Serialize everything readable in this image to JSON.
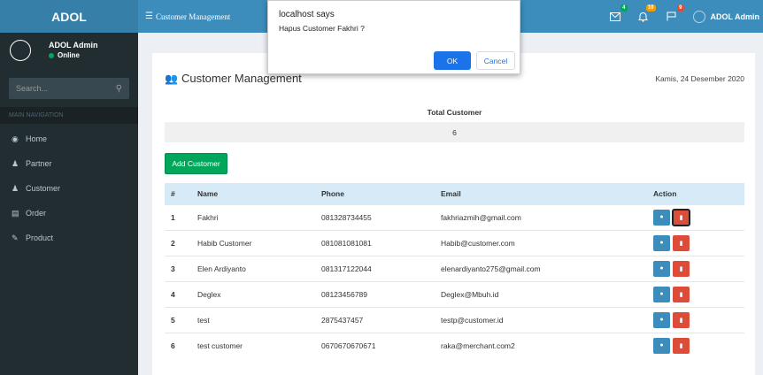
{
  "app": {
    "logo": "ADOL",
    "nav_title": "Customer Management"
  },
  "topbar": {
    "notifications": [
      {
        "icon": "envelope-icon",
        "badge": "4",
        "color": "#00a65a"
      },
      {
        "icon": "bell-icon",
        "badge": "10",
        "color": "#f39c12"
      },
      {
        "icon": "flag-icon",
        "badge": "9",
        "color": "#dd4b39"
      }
    ],
    "user_name": "ADOL Admin"
  },
  "sidebar": {
    "user_name": "ADOL Admin",
    "status": "Online",
    "search_placeholder": "Search...",
    "header": "MAIN NAVIGATION",
    "items": [
      {
        "label": "Home",
        "icon": "dashboard-icon"
      },
      {
        "label": "Partner",
        "icon": "users-icon"
      },
      {
        "label": "Customer",
        "icon": "users-icon"
      },
      {
        "label": "Order",
        "icon": "book-icon"
      },
      {
        "label": "Product",
        "icon": "edit-icon"
      }
    ]
  },
  "main": {
    "title": "Customer Management",
    "date": "Kamis, 24 Desember 2020",
    "total_label": "Total Customer",
    "total_value": "6",
    "add_button": "Add Customer",
    "columns": [
      "#",
      "Name",
      "Phone",
      "Email",
      "Action"
    ],
    "rows": [
      {
        "no": "1",
        "name": "Fakhri",
        "phone": "081328734455",
        "email": "fakhriazmih@gmail.com"
      },
      {
        "no": "2",
        "name": "Habib Customer",
        "phone": "081081081081",
        "email": "Habib@customer.com"
      },
      {
        "no": "3",
        "name": "Elen Ardiyanto",
        "phone": "081317122044",
        "email": "elenardiyanto275@gmail.com"
      },
      {
        "no": "4",
        "name": "Deglex",
        "phone": "08123456789",
        "email": "Deglex@Mbuh.id"
      },
      {
        "no": "5",
        "name": "test",
        "phone": "2875437457",
        "email": "testp@customer.id"
      },
      {
        "no": "6",
        "name": "test customer",
        "phone": "0670670670671",
        "email": "raka@merchant.com2"
      }
    ]
  },
  "dialog": {
    "title": "localhost says",
    "message": "Hapus Customer Fakhri ?",
    "ok": "OK",
    "cancel": "Cancel"
  },
  "colors": {
    "primary": "#3c8dbc",
    "success": "#00a65a",
    "danger": "#dd4b39",
    "sidebar": "#222d32",
    "dialog_button": "#1a73e8"
  }
}
